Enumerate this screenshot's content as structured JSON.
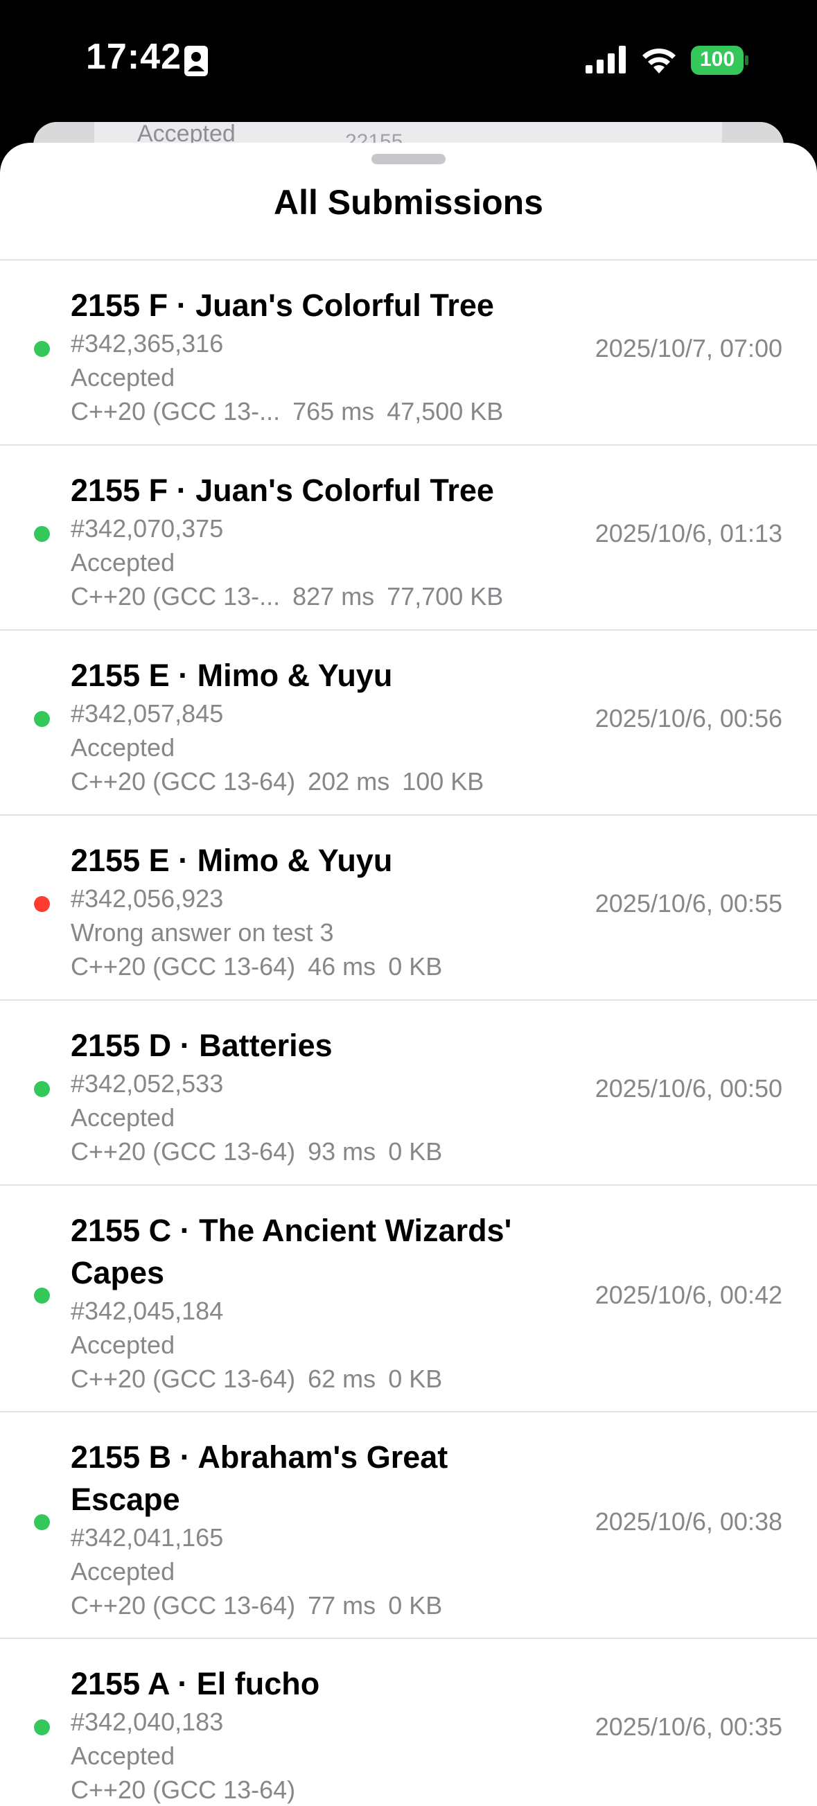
{
  "status_bar": {
    "time": "17:42",
    "battery": "100",
    "icons": [
      "contact-card-icon",
      "cellular-signal-icon",
      "wifi-icon",
      "battery-icon"
    ]
  },
  "background_sheet": {
    "text": "Accepted",
    "text2": "22155"
  },
  "sheet": {
    "title": "All Submissions"
  },
  "colors": {
    "accepted": "#34c759",
    "rejected": "#ff3b30"
  },
  "submissions": [
    {
      "problem": "2155 F · Juan's Colorful Tree",
      "id": "#342,365,316",
      "verdict": "Accepted",
      "language": "C++20 (GCC 13-...",
      "time": "765 ms",
      "memory": "47,500 KB",
      "date": "2025/10/7, 07:00",
      "status": "accepted"
    },
    {
      "problem": "2155 F · Juan's Colorful Tree",
      "id": "#342,070,375",
      "verdict": "Accepted",
      "language": "C++20 (GCC 13-...",
      "time": "827 ms",
      "memory": "77,700 KB",
      "date": "2025/10/6, 01:13",
      "status": "accepted"
    },
    {
      "problem": "2155 E · Mimo & Yuyu",
      "id": "#342,057,845",
      "verdict": "Accepted",
      "language": "C++20 (GCC 13-64)",
      "time": "202 ms",
      "memory": "100 KB",
      "date": "2025/10/6, 00:56",
      "status": "accepted"
    },
    {
      "problem": "2155 E · Mimo & Yuyu",
      "id": "#342,056,923",
      "verdict": "Wrong answer on test 3",
      "language": "C++20 (GCC 13-64)",
      "time": "46 ms",
      "memory": "0 KB",
      "date": "2025/10/6, 00:55",
      "status": "rejected"
    },
    {
      "problem": "2155 D · Batteries",
      "id": "#342,052,533",
      "verdict": "Accepted",
      "language": "C++20 (GCC 13-64)",
      "time": "93 ms",
      "memory": "0 KB",
      "date": "2025/10/6, 00:50",
      "status": "accepted"
    },
    {
      "problem": "2155 C · The Ancient Wizards' Capes",
      "id": "#342,045,184",
      "verdict": "Accepted",
      "language": "C++20 (GCC 13-64)",
      "time": "62 ms",
      "memory": "0 KB",
      "date": "2025/10/6, 00:42",
      "status": "accepted"
    },
    {
      "problem": "2155 B · Abraham's Great Escape",
      "id": "#342,041,165",
      "verdict": "Accepted",
      "language": "C++20 (GCC 13-64)",
      "time": "77 ms",
      "memory": "0 KB",
      "date": "2025/10/6, 00:38",
      "status": "accepted"
    },
    {
      "problem": "2155 A · El fucho",
      "id": "#342,040,183",
      "verdict": "Accepted",
      "language": "C++20 (GCC 13-64)",
      "time": "",
      "memory": "",
      "date": "2025/10/6, 00:35",
      "status": "accepted"
    }
  ]
}
